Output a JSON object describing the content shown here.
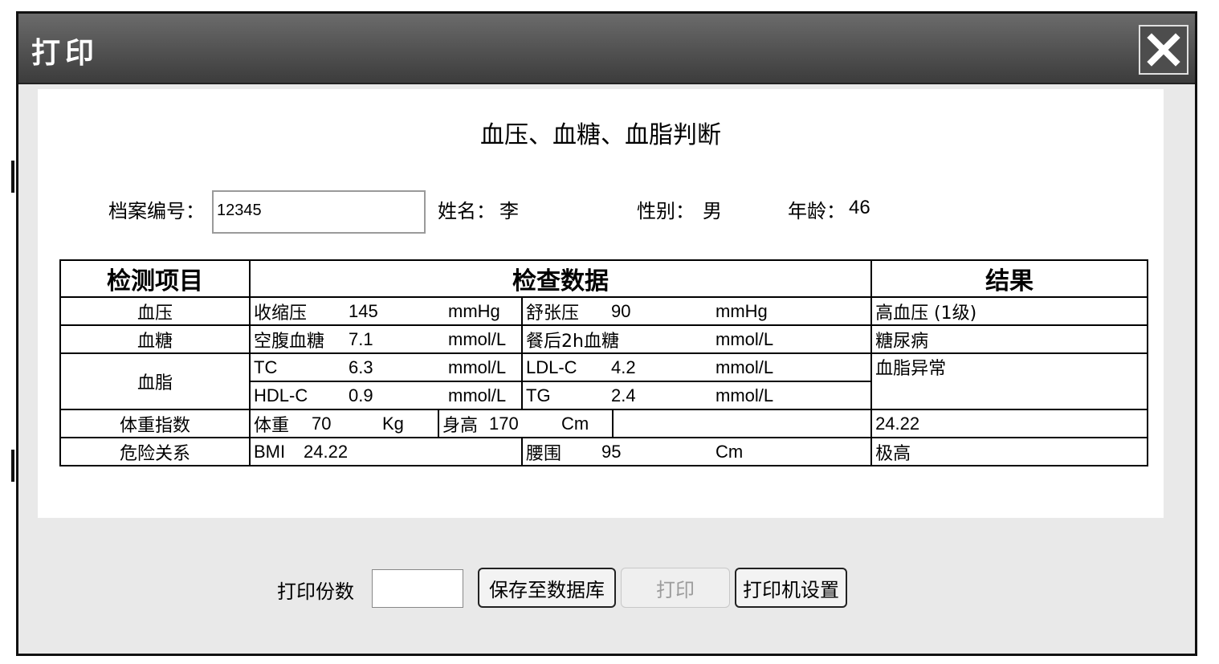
{
  "window": {
    "title": "打印"
  },
  "report": {
    "heading": "血压、血糖、血脂判断",
    "record_no_label": "档案编号：",
    "record_no_value": "12345",
    "name_label": "姓名：",
    "name_value": "李",
    "gender_label": "性别：",
    "gender_value": "男",
    "age_label": "年龄：",
    "age_value": "46"
  },
  "table": {
    "headers": [
      "检测项目",
      "检查数据",
      "结果"
    ],
    "rows": {
      "bp": {
        "item": "血压",
        "a_label": "收缩压",
        "a_value": "145",
        "a_unit": "mmHg",
        "b_label": "舒张压",
        "b_value": "90",
        "b_unit": "mmHg",
        "result": "高血压 (1级)"
      },
      "glucose": {
        "item": "血糖",
        "a_label": "空腹血糖",
        "a_value": "7.1",
        "a_unit": "mmol/L",
        "b_label": "餐后2h血糖",
        "b_value": "",
        "b_unit": "mmol/L",
        "result": "糖尿病"
      },
      "lipid": {
        "item": "血脂",
        "r1_a_label": "TC",
        "r1_a_value": "6.3",
        "r1_a_unit": "mmol/L",
        "r1_b_label": "LDL-C",
        "r1_b_value": "4.2",
        "r1_b_unit": "mmol/L",
        "r2_a_label": "HDL-C",
        "r2_a_value": "0.9",
        "r2_a_unit": "mmol/L",
        "r2_b_label": "TG",
        "r2_b_value": "2.4",
        "r2_b_unit": "mmol/L",
        "result": "血脂异常"
      },
      "weight": {
        "item": "体重指数",
        "weight_label": "体重",
        "weight_value": "70",
        "weight_unit": "Kg",
        "height_label": "身高",
        "height_value": "170",
        "height_unit": "Cm",
        "result": "24.22"
      },
      "risk": {
        "item": "危险关系",
        "bmi_label": "BMI",
        "bmi_value": "24.22",
        "waist_label": "腰围",
        "waist_value": "95",
        "waist_unit": "Cm",
        "result": "极高"
      }
    }
  },
  "footer": {
    "copies_label": "打印份数",
    "copies_value": "",
    "save_label": "保存至数据库",
    "print_label": "打印",
    "printer_settings_label": "打印机设置"
  }
}
